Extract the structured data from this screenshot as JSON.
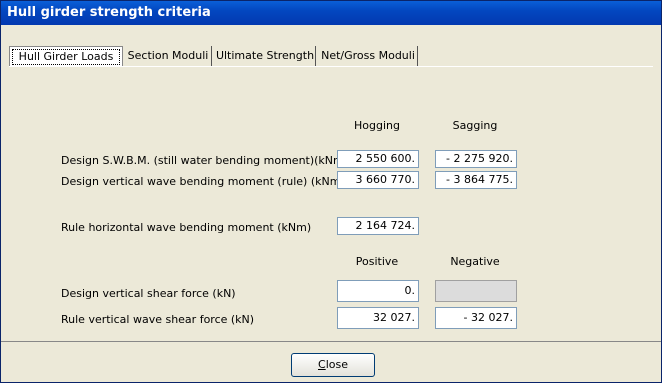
{
  "window": {
    "title": "Hull girder strength criteria"
  },
  "tabs": [
    {
      "label": "Hull Girder Loads"
    },
    {
      "label": "Section Moduli"
    },
    {
      "label": "Ultimate Strength"
    },
    {
      "label": "Net/Gross Moduli"
    }
  ],
  "headers": {
    "hogging": "Hogging",
    "sagging": "Sagging",
    "positive": "Positive",
    "negative": "Negative"
  },
  "rows": {
    "swbm": {
      "label": "Design S.W.B.M. (still water bending moment)(kNm)",
      "hogging": "2 550 600.",
      "sagging": "- 2 275 920."
    },
    "vwbm": {
      "label": "Design vertical wave bending moment (rule) (kNm)",
      "hogging": "3 660 770.",
      "sagging": "- 3 864 775."
    },
    "hwbm": {
      "label": "Rule horizontal wave bending moment (kNm)",
      "value": "2 164 724."
    },
    "vsf": {
      "label": "Design vertical shear force (kN)",
      "positive": "0.",
      "negative": ""
    },
    "rvwsf": {
      "label": "Rule vertical wave shear force (kN)",
      "positive": "32 027.",
      "negative": "- 32 027."
    }
  },
  "buttons": {
    "close": {
      "prefix": "C",
      "rest": "lose"
    }
  }
}
